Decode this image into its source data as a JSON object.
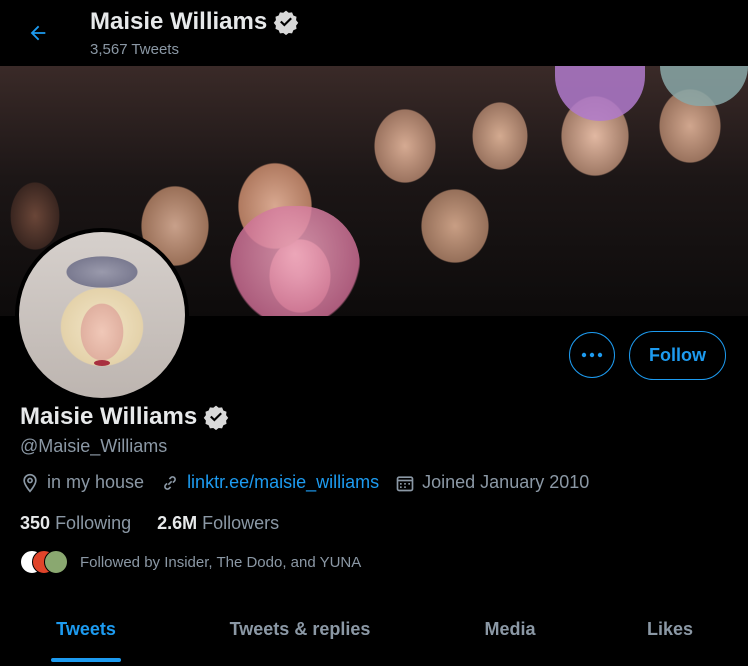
{
  "header": {
    "name": "Maisie Williams",
    "tweet_count": "3,567 Tweets",
    "back_icon": "arrow-left-icon"
  },
  "profile": {
    "name": "Maisie Williams",
    "handle": "@Maisie_Williams",
    "location": "in my house",
    "website": "linktr.ee/maisie_williams",
    "joined": "Joined January 2010",
    "following_count": "350",
    "following_label": "Following",
    "followers_count": "2.6M",
    "followers_label": "Followers",
    "followed_by": "Followed by Insider, The Dodo, and YUNA"
  },
  "actions": {
    "follow_label": "Follow",
    "more_icon": "more-icon"
  },
  "tabs": [
    {
      "label": "Tweets",
      "active": true
    },
    {
      "label": "Tweets & replies",
      "active": false
    },
    {
      "label": "Media",
      "active": false
    },
    {
      "label": "Likes",
      "active": false
    }
  ],
  "colors": {
    "accent": "#1d9bf0",
    "background": "#000000",
    "text_primary": "#e7e9ea",
    "text_secondary": "#8b98a5"
  }
}
